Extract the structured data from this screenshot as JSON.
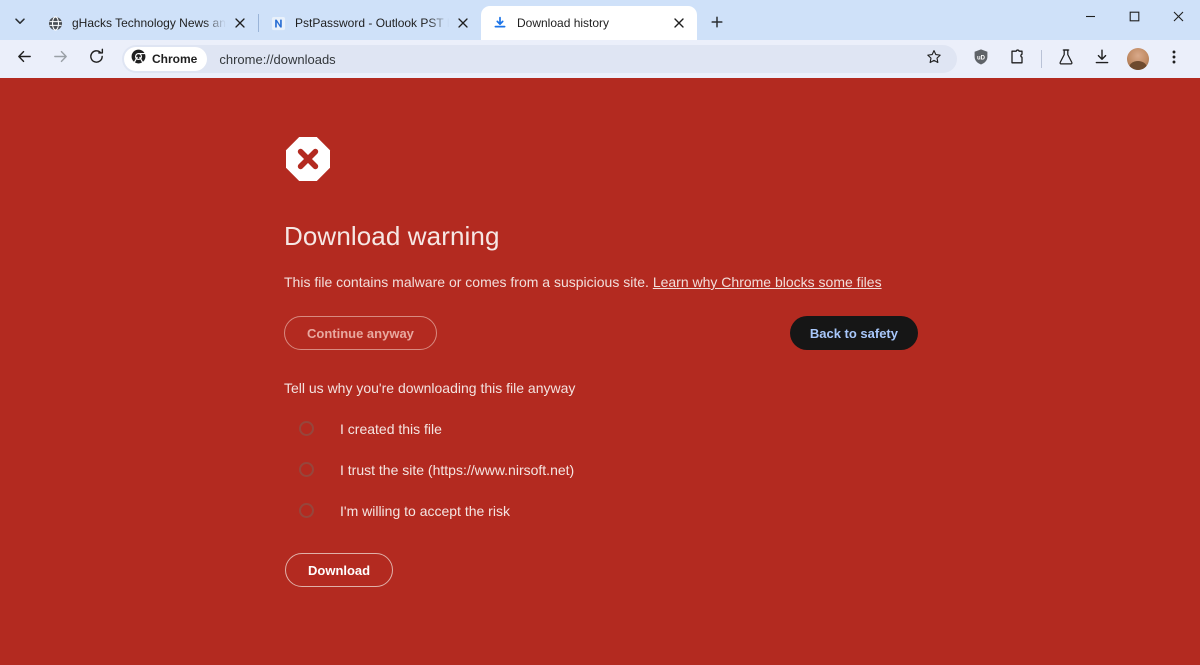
{
  "window": {
    "controls": {
      "minimize": "minimize-window",
      "maximize": "maximize-window",
      "close": "close-window"
    }
  },
  "tabstrip": {
    "tab_search_icon": "chevron-down-icon",
    "new_tab_label": "+",
    "tabs": [
      {
        "title": "gHacks Technology News and A",
        "favicon": "globe-icon",
        "active": false
      },
      {
        "title": "PstPassword - Outlook PST Pas",
        "favicon": "nirsoft-n-icon",
        "active": false
      },
      {
        "title": "Download history",
        "favicon": "download-icon",
        "active": true
      }
    ]
  },
  "toolbar": {
    "back_icon": "back-arrow-icon",
    "forward_icon": "forward-arrow-icon",
    "reload_icon": "reload-icon",
    "chrome_chip_label": "Chrome",
    "url": "chrome://downloads",
    "bookmark_icon": "star-icon",
    "ublock_icon": "ublock-shield-icon",
    "extensions_icon": "extensions-puzzle-icon",
    "labs_icon": "flask-icon",
    "downloads_icon": "download-tray-icon",
    "profile_icon": "avatar",
    "menu_icon": "three-dot-menu-icon"
  },
  "page": {
    "background_color": "#b32a20",
    "warning_icon": "octagon-x-icon",
    "heading": "Download warning",
    "description": "This file contains malware or comes from a suspicious site.",
    "learn_more_link": "Learn why Chrome blocks some files",
    "continue_button": "Continue anyway",
    "back_to_safety_button": "Back to safety",
    "back_to_safety_color": "#a8c7fa",
    "prompt": "Tell us why you're downloading this file anyway",
    "radio_options": [
      {
        "label": "I created this file",
        "selected": false
      },
      {
        "label": "I trust the site (https://www.nirsoft.net)",
        "selected": false
      },
      {
        "label": "I'm willing to accept the risk",
        "selected": false
      }
    ],
    "download_button": "Download"
  }
}
